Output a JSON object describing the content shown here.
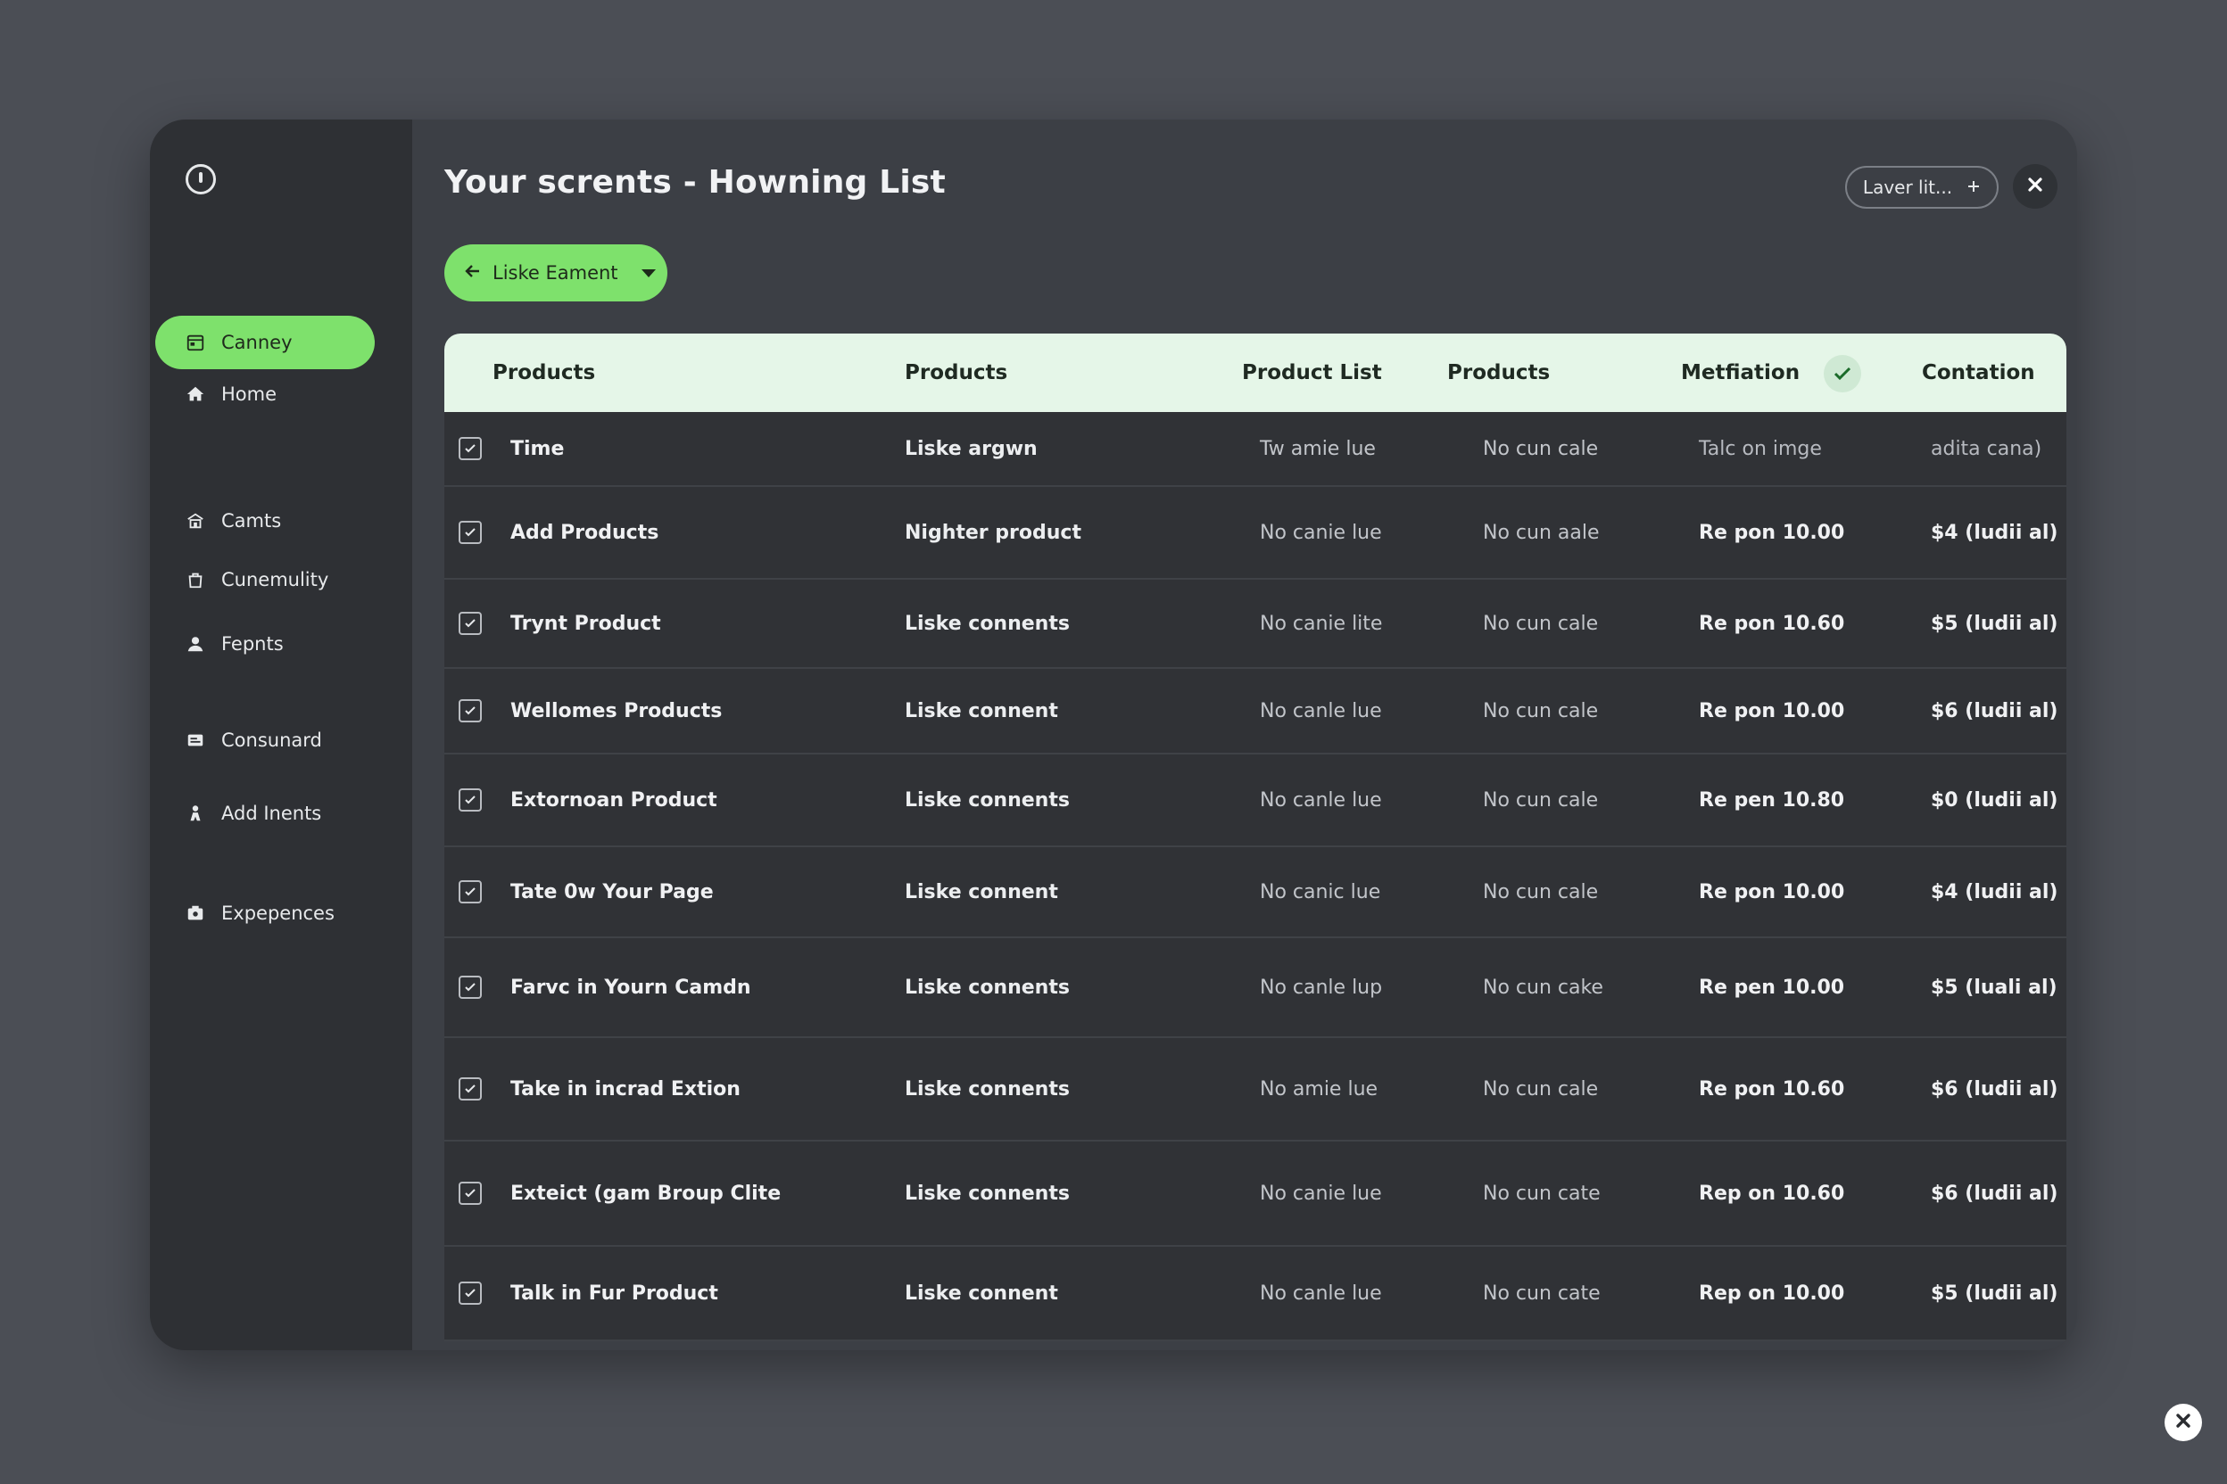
{
  "window": {
    "title": "Your scrents - Howning List",
    "pill_button_label": "Laver lit...",
    "filter_label": "Liske Eament"
  },
  "sidebar": {
    "items": [
      {
        "label": "Home",
        "icon": "home-icon"
      },
      {
        "label": "Canney",
        "icon": "calendar-icon",
        "active": true
      },
      {
        "label": "Camts",
        "icon": "building-icon"
      },
      {
        "label": "Cunemulity",
        "icon": "bag-icon"
      },
      {
        "label": "Fepnts",
        "icon": "user-icon"
      },
      {
        "label": "Consunard",
        "icon": "card-icon"
      },
      {
        "label": "Add Inents",
        "icon": "person-add-icon"
      },
      {
        "label": "Expepences",
        "icon": "wallet-icon"
      }
    ]
  },
  "table": {
    "headers": [
      "Products",
      "Products",
      "Product List",
      "Products",
      "Metfiation",
      "Contation"
    ],
    "rows": [
      [
        "Time",
        "Liske argwn",
        "Tw amie lue",
        "No cun cale",
        "Talc on imge",
        "adita cana)"
      ],
      [
        "Add Products",
        "Nighter product",
        "No canie lue",
        "No cun aale",
        "Re pon 10.00",
        "$4 (ludii al)"
      ],
      [
        "Trynt Product",
        "Liske connents",
        "No canie lite",
        "No cun cale",
        "Re pon 10.60",
        "$5 (ludii al)"
      ],
      [
        "Wellomes Products",
        "Liske connent",
        "No canle lue",
        "No cun cale",
        "Re pon 10.00",
        "$6 (ludii al)"
      ],
      [
        "Extornoan Product",
        "Liske connents",
        "No canle lue",
        "No cun cale",
        "Re pen 10.80",
        "$0 (ludii al)"
      ],
      [
        "Tate 0w Your Page",
        "Liske connent",
        "No canic lue",
        "No cun cale",
        "Re pon 10.00",
        "$4 (ludii al)"
      ],
      [
        "Farvc in Yourn Camdn",
        "Liske connents",
        "No canle lup",
        "No cun cake",
        "Re pen 10.00",
        "$5 (luali al)"
      ],
      [
        "Take in incrad Extion",
        "Liske connents",
        "No amie lue",
        "No cun cale",
        "Re pon 10.60",
        "$6 (ludii al)"
      ],
      [
        "Exteict (gam Broup Clite",
        "Liske connents",
        "No canie lue",
        "No cun cate",
        "Rep on 10.60",
        "$6 (ludii al)"
      ],
      [
        "Talk in Fur Product",
        "Liske connent",
        "No canle lue",
        "No cun cate",
        "Rep on 10.00",
        "$5 (ludii al)"
      ]
    ]
  },
  "colors": {
    "accent": "#7ee16c",
    "header_bg": "#e5f6e8",
    "background": "#4b4e55"
  }
}
